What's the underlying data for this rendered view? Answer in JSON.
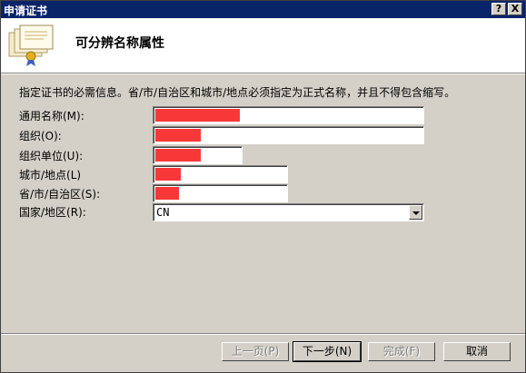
{
  "window": {
    "title": "申请证书",
    "help_button": "?",
    "close_button": "X"
  },
  "header": {
    "title": "可分辨名称属性",
    "icon": "certificate-icon"
  },
  "instruction": "指定证书的必需信息。省/市/自治区和城市/地点必须指定为正式名称，并且不得包含缩写。",
  "form": {
    "common_name_label": "通用名称(M):",
    "organization_label": "组织(O):",
    "org_unit_label": "组织单位(U):",
    "city_label": "城市/地点(L)",
    "state_label": "省/市/自治区(S):",
    "country_label": "国家/地区(R):",
    "country_value": "CN"
  },
  "buttons": {
    "back": "上一页(P)",
    "next": "下一步(N)",
    "finish": "完成(F)",
    "cancel": "取消"
  }
}
